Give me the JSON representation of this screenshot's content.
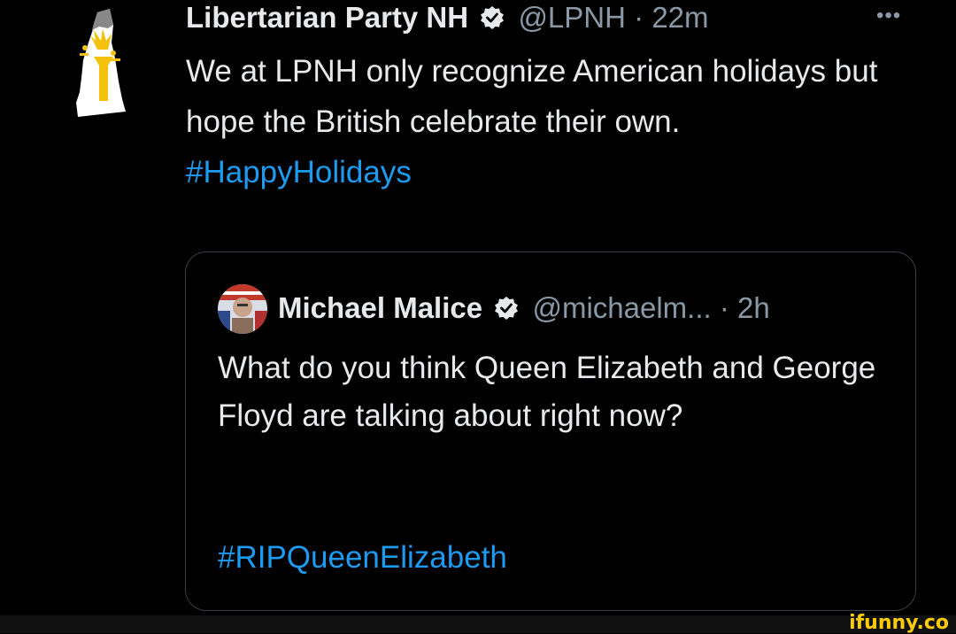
{
  "tweet": {
    "author_name": "Libertarian Party NH",
    "handle": "@LPNH",
    "separator": "·",
    "time": "22m",
    "more_label": "•••",
    "body_text": "We at LPNH only recognize American holidays but hope the British celebrate their own.",
    "hashtag": "#HappyHolidays"
  },
  "quote": {
    "author_name": "Michael Malice",
    "handle": "@michaelm...",
    "separator": "·",
    "time": "2h",
    "body_text": "What do you think Queen Elizabeth and George Floyd are talking about right now?",
    "hashtag": "#RIPQueenElizabeth"
  },
  "watermark": {
    "text": "ifunny.co"
  },
  "colors": {
    "background": "#000000",
    "text": "#e7e9ea",
    "muted": "#8b98a5",
    "link": "#1d9bf0",
    "border": "#3a3f44",
    "watermark": "#ffcc00"
  }
}
